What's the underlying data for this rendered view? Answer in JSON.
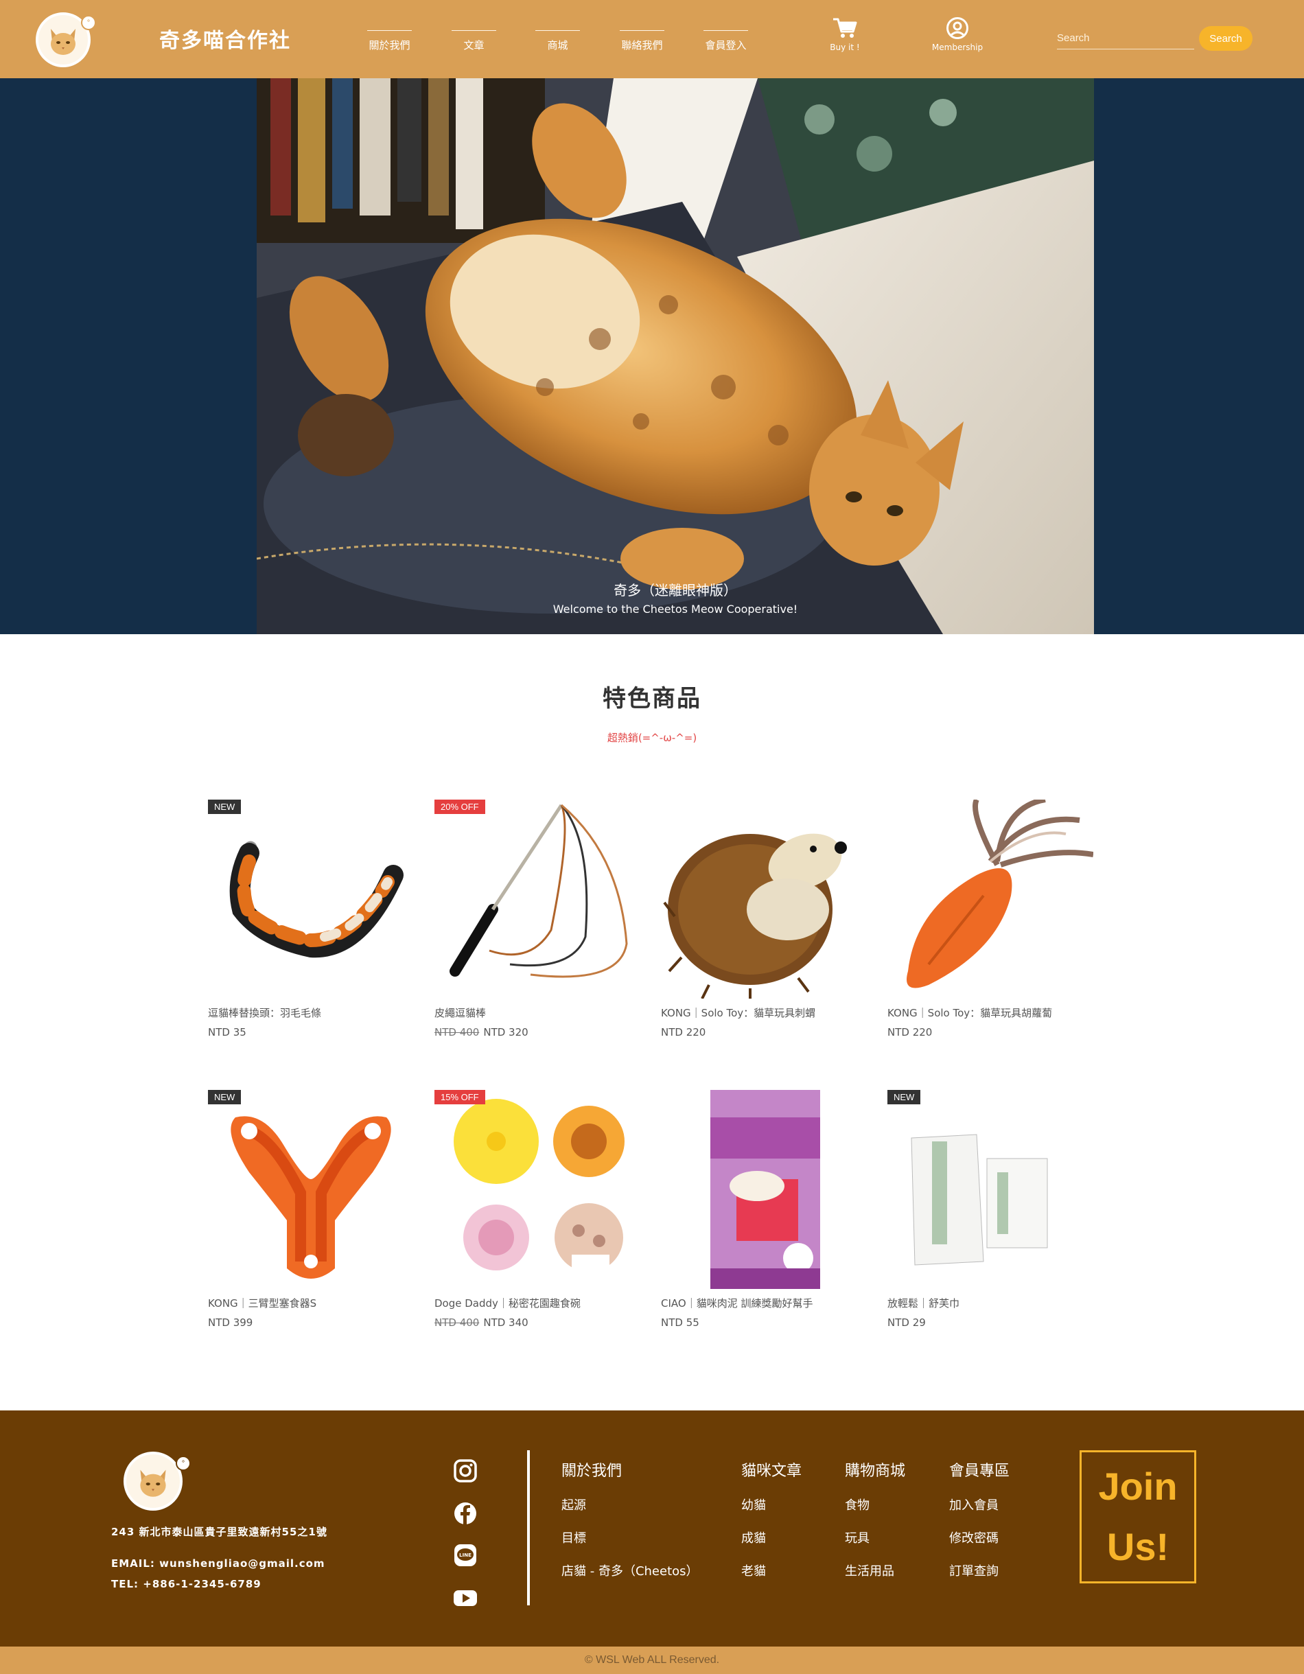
{
  "header": {
    "brand": "奇多喵合作社",
    "nav": [
      "關於我們",
      "文章",
      "商城",
      "聯絡我們",
      "會員登入"
    ],
    "cart_label": "Buy it !",
    "membership_label": "Membership",
    "search_placeholder": "Search",
    "search_button": "Search",
    "logo_bubble": "°"
  },
  "hero": {
    "title": "奇多（迷離眼神版）",
    "subtitle": "Welcome to the Cheetos Meow Cooperative!"
  },
  "featured": {
    "title": "特色商品",
    "subtitle": "超熱銷(=^-ω-^=)",
    "products": [
      {
        "name": "逗貓棒替換頭：羽毛毛條",
        "price": "NTD 35",
        "old_price": "",
        "badge": "NEW",
        "badge_type": "new",
        "image": "feather-tail-toy"
      },
      {
        "name": "皮繩逗貓棒",
        "price": "NTD 320",
        "old_price": "NTD 400",
        "badge": "20% OFF",
        "badge_type": "off",
        "image": "leather-wand-toy"
      },
      {
        "name": "KONG｜Solo Toy：貓草玩具刺蝟",
        "price": "NTD 220",
        "old_price": "",
        "badge": "",
        "badge_type": "",
        "image": "hedgehog-toy"
      },
      {
        "name": "KONG｜Solo Toy：貓草玩具胡蘿蔔",
        "price": "NTD 220",
        "old_price": "",
        "badge": "",
        "badge_type": "",
        "image": "carrot-toy"
      },
      {
        "name": "KONG｜三臂型塞食器S",
        "price": "NTD 399",
        "old_price": "",
        "badge": "NEW",
        "badge_type": "new",
        "image": "y-feeder"
      },
      {
        "name": "Doge Daddy｜秘密花園趣食碗",
        "price": "NTD 340",
        "old_price": "NTD 400",
        "badge": "15% OFF",
        "badge_type": "off",
        "image": "flower-bowls"
      },
      {
        "name": "CIAO｜貓咪肉泥 訓練獎勵好幫手",
        "price": "NTD 55",
        "old_price": "",
        "badge": "",
        "badge_type": "",
        "image": "ciao-churu"
      },
      {
        "name": "放輕鬆｜舒芙巾",
        "price": "NTD 29",
        "old_price": "",
        "badge": "NEW",
        "badge_type": "new",
        "image": "pet-remedy-wipes"
      }
    ]
  },
  "footer": {
    "address": "243 新北市泰山區貴子里致遠新村55之1號",
    "email": "EMAIL: wunshengliao@gmail.com",
    "tel": "TEL: +886-1-2345-6789",
    "social": [
      "instagram-icon",
      "facebook-icon",
      "line-icon",
      "youtube-icon"
    ],
    "columns": [
      {
        "title": "關於我們",
        "links": [
          "起源",
          "目標",
          "店貓 - 奇多（Cheetos）"
        ]
      },
      {
        "title": "貓咪文章",
        "links": [
          "幼貓",
          "成貓",
          "老貓"
        ]
      },
      {
        "title": "購物商城",
        "links": [
          "食物",
          "玩具",
          "生活用品"
        ]
      },
      {
        "title": "會員專區",
        "links": [
          "加入會員",
          "修改密碼",
          "訂單查詢"
        ]
      }
    ],
    "join_line1": "Join",
    "join_line2": "Us!",
    "copyright": "© WSL Web ALL Reserved."
  },
  "colors": {
    "header_bg": "#d99f55",
    "hero_bg": "#142e48",
    "footer_bg": "#6b3d05",
    "accent": "#f7b42a",
    "sale_red": "#e53e3e"
  }
}
